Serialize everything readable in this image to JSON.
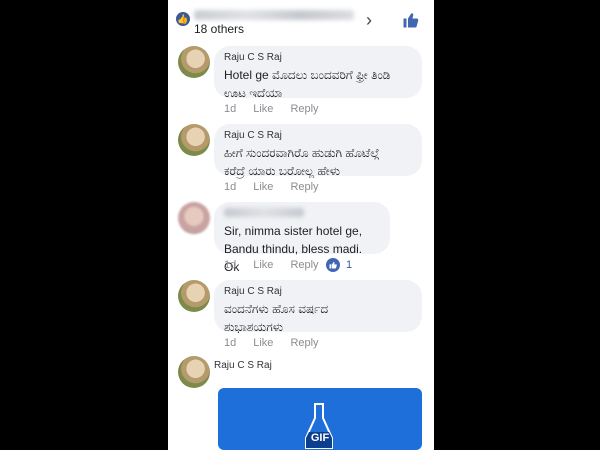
{
  "header": {
    "others_text": "18 others",
    "chevron": "›",
    "reaction_icon": "thumbs-up-icon"
  },
  "comments": [
    {
      "author": "Raju C S Raj",
      "lines": [
        "Hotel ge  ಮೊದಲು ಬಂದವರಿಗೆ ಫ್ರೀ ತಿಂಡಿ",
        "ಊಟ ಇದೆಯಾ"
      ],
      "time": "1d",
      "like_label": "Like",
      "reply_label": "Reply"
    },
    {
      "author": "Raju C S Raj",
      "lines": [
        "ಹೀಗೆ ಸುಂದರವಾಗಿರೊ ಹುಡುಗಿ ಹೊಟೆಲ್ಗೆ",
        "ಕರೆದ್ರೆ ಯಾರು ಬರೋಲ್ಲ ಹೇಳು"
      ],
      "time": "1d",
      "like_label": "Like",
      "reply_label": "Reply"
    },
    {
      "author": "",
      "lines": [
        "Sir, nimma sister hotel ge,",
        "Bandu thindu, bless madi. Ok"
      ],
      "time": "1d",
      "like_label": "Like",
      "reply_label": "Reply",
      "reaction_count": "1"
    },
    {
      "author": "Raju C S Raj",
      "lines": [
        "ವಂದನೆಗಳು ಹೊಸ ವರ್ಷದ",
        "ಶುಭಾಶಯಗಳು"
      ],
      "time": "1d",
      "like_label": "Like",
      "reply_label": "Reply"
    }
  ],
  "last_comment": {
    "author": "Raju C S Raj",
    "gif_label": "GIF"
  },
  "colors": {
    "facebook_blue": "#4267b2",
    "bubble_bg": "#f0f2f5",
    "gif_bg": "#1e6fd9"
  }
}
